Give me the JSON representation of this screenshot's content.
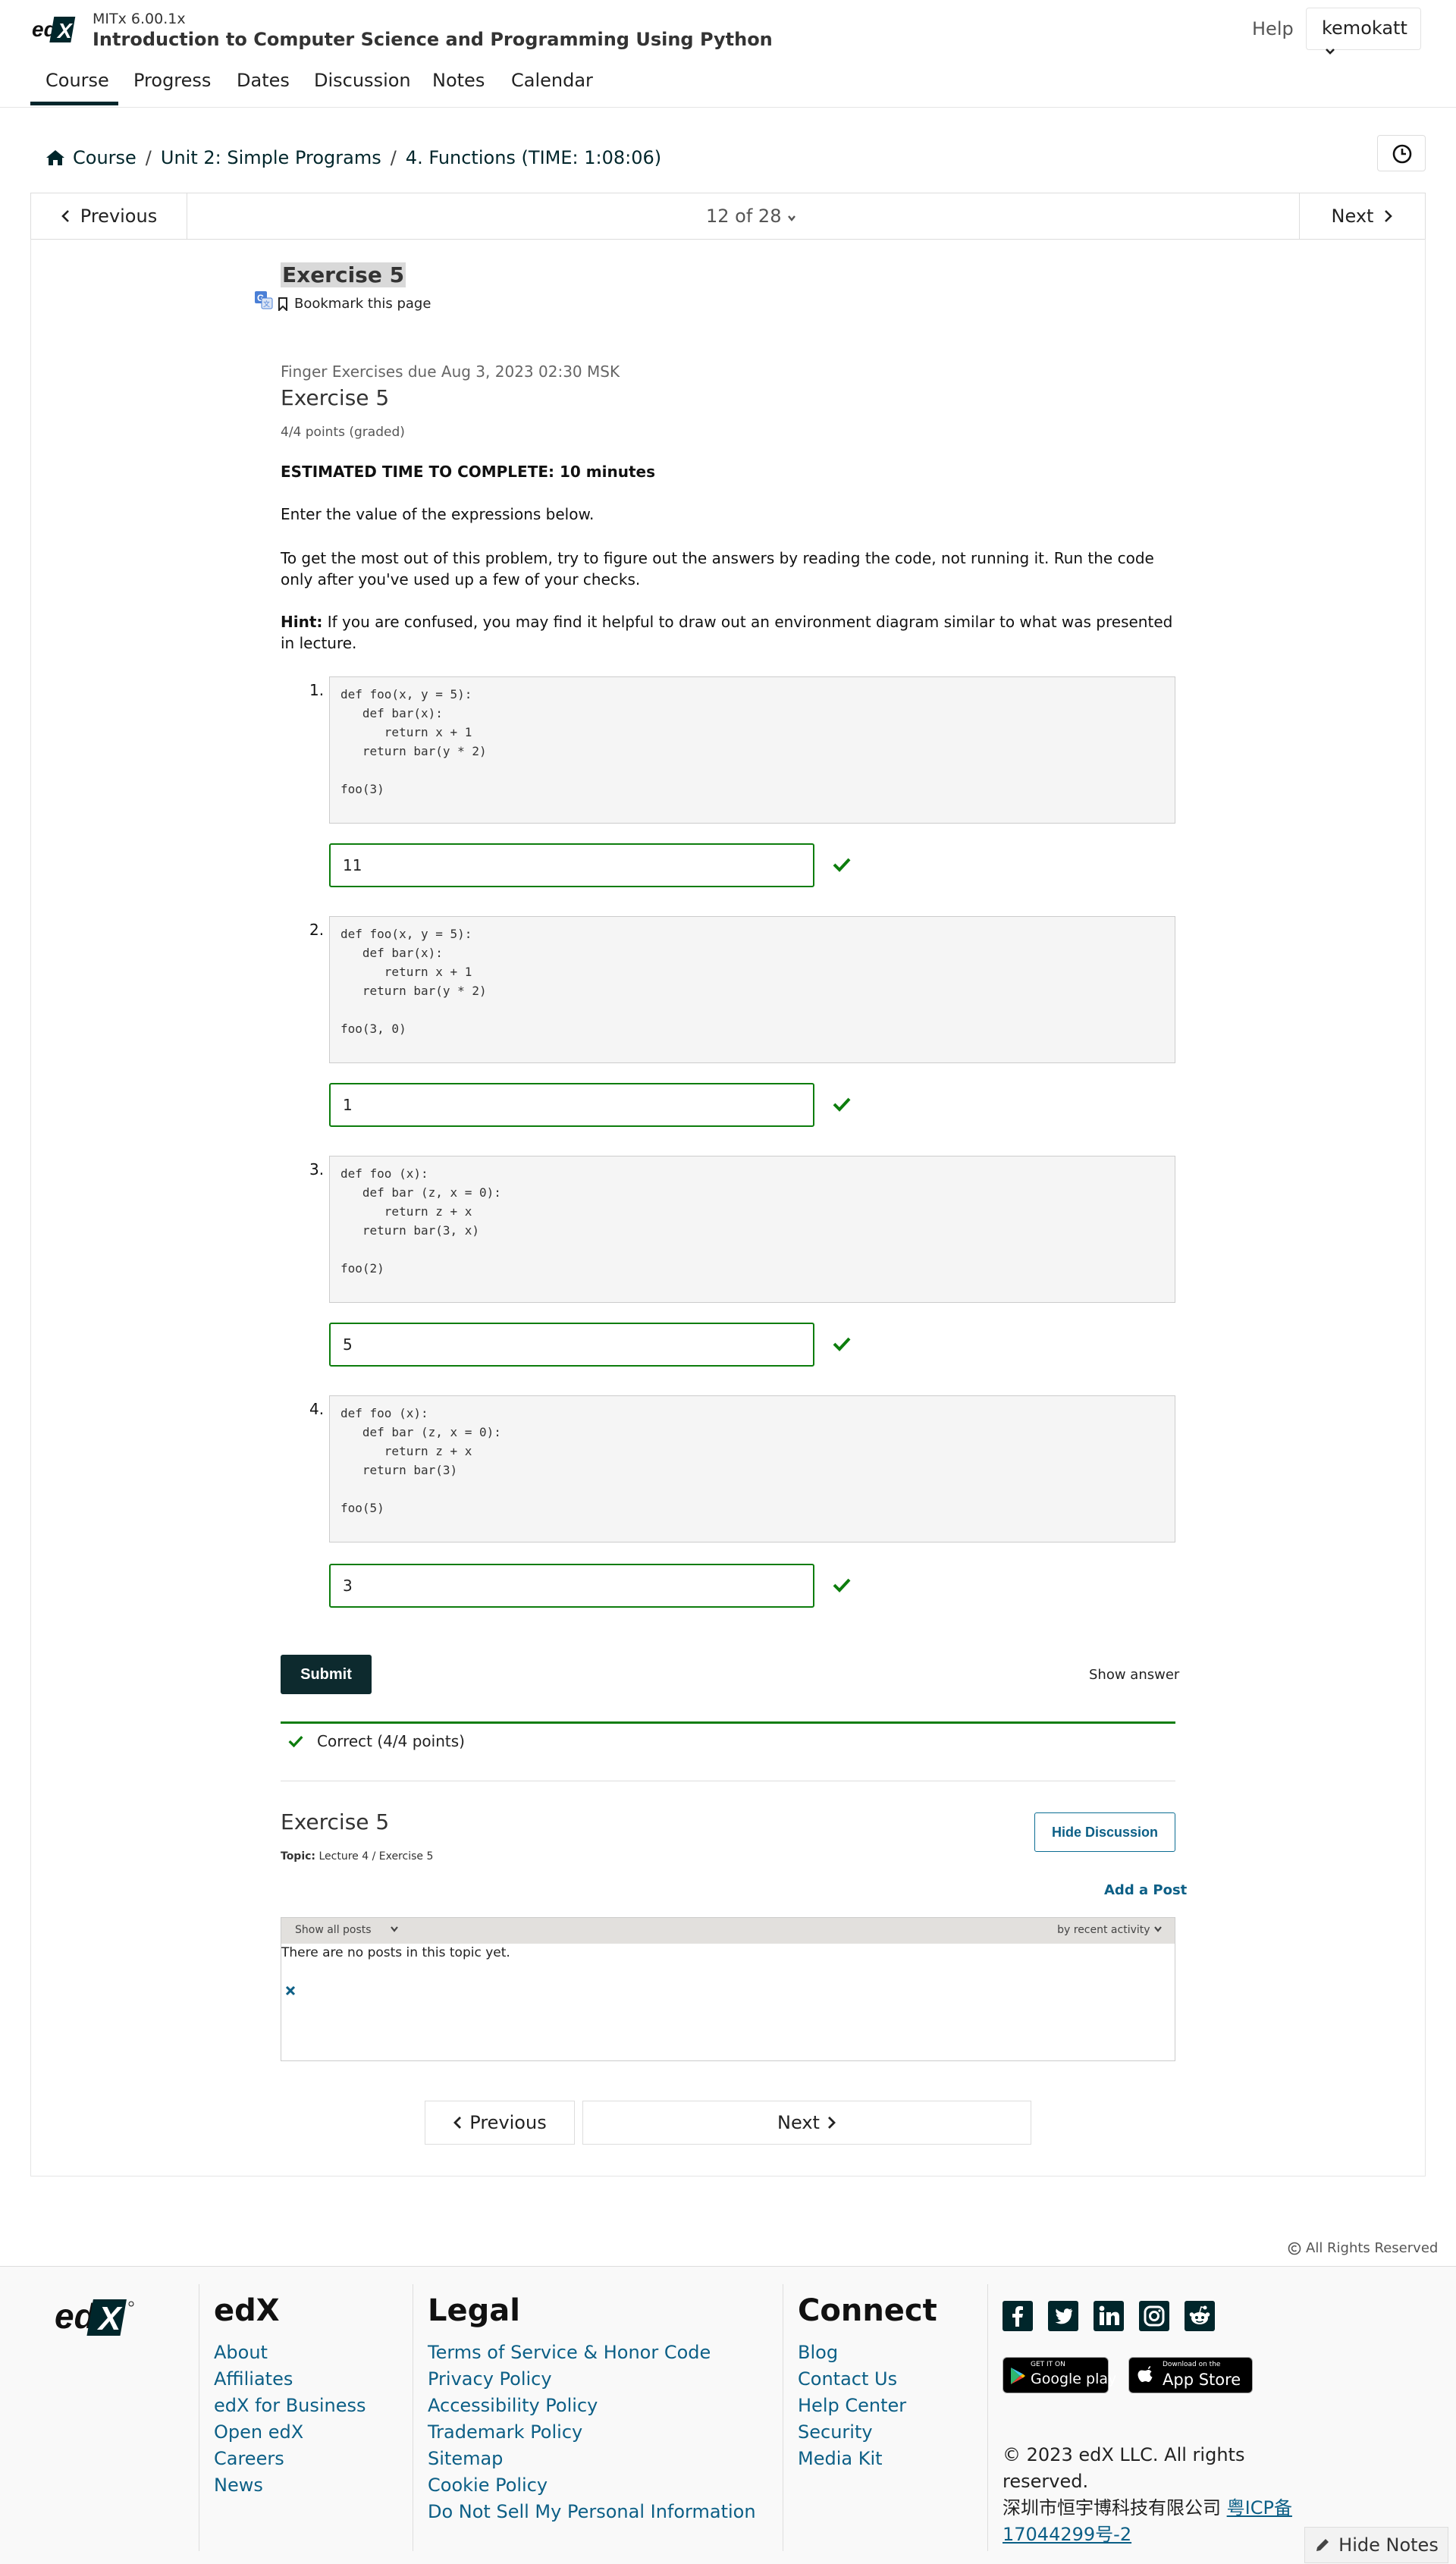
{
  "header": {
    "course_org": "MITx 6.00.1x",
    "course_title": "Introduction to Computer Science and Programming Using Python",
    "help": "Help",
    "username": "kemokatt",
    "tabs": [
      "Course",
      "Progress",
      "Dates",
      "Discussion",
      "Notes",
      "Calendar"
    ],
    "active_tab": "Course"
  },
  "breadcrumb": [
    "Course",
    "Unit 2: Simple Programs",
    "4. Functions (TIME: 1:08:06)"
  ],
  "sequence_nav": {
    "previous": "Previous",
    "position": "12 of 28",
    "next": "Next"
  },
  "unit": {
    "title": "Exercise 5",
    "bookmark": "Bookmark this page"
  },
  "problem": {
    "due": "Finger Exercises due Aug 3, 2023 02:30 MSK",
    "title": "Exercise 5",
    "points": "4/4 points (graded)",
    "estimated_time": "ESTIMATED TIME TO COMPLETE: 10 minutes",
    "instruction": "Enter the value of the expressions below.",
    "advice": "To get the most out of this problem, try to figure out the answers by reading the code, not running it. Run the code only after you've used up a few of your checks.",
    "hint_label": "Hint:",
    "hint_text": " If you are confused, you may find it helpful to draw out an environment diagram similar to what was presented in lecture.",
    "questions": [
      {
        "num": "1.",
        "code": "def foo(x, y = 5):\n   def bar(x):\n      return x + 1\n   return bar(y * 2)\n\nfoo(3)",
        "answer": "11",
        "status": "correct"
      },
      {
        "num": "2.",
        "code": "def foo(x, y = 5):\n   def bar(x):\n      return x + 1\n   return bar(y * 2)\n\nfoo(3, 0)",
        "answer": "1",
        "status": "correct"
      },
      {
        "num": "3.",
        "code": "def foo (x):\n   def bar (z, x = 0):\n      return z + x\n   return bar(3, x)\n\nfoo(2)",
        "answer": "5",
        "status": "correct"
      },
      {
        "num": "4.",
        "code": "def foo (x):\n   def bar (z, x = 0):\n      return z + x\n   return bar(3)\n\nfoo(5)",
        "answer": "3",
        "status": "correct"
      }
    ],
    "submit": "Submit",
    "show_answer": "Show answer",
    "result": "Correct (4/4 points)"
  },
  "discussion": {
    "title": "Exercise 5",
    "topic_label": "Topic:",
    "topic": " Lecture 4 / Exercise 5",
    "hide_button": "Hide Discussion",
    "add_post": "Add a Post",
    "filter": "Show all posts",
    "sort": "by recent activity",
    "empty": "There are no posts in this topic yet."
  },
  "bottom_nav": {
    "previous": "Previous",
    "next": "Next"
  },
  "all_rights": "All Rights Reserved",
  "footer": {
    "edx": {
      "heading": "edX",
      "links": [
        "About",
        "Affiliates",
        "edX for Business",
        "Open edX",
        "Careers",
        "News"
      ]
    },
    "legal": {
      "heading": "Legal",
      "links": [
        "Terms of Service & Honor Code",
        "Privacy Policy",
        "Accessibility Policy",
        "Trademark Policy",
        "Sitemap",
        "Cookie Policy",
        "Do Not Sell My Personal Information"
      ]
    },
    "connect": {
      "heading": "Connect",
      "links": [
        "Blog",
        "Contact Us",
        "Help Center",
        "Security",
        "Media Kit"
      ]
    },
    "social_icons": [
      "facebook-icon",
      "twitter-icon",
      "linkedin-icon",
      "instagram-icon",
      "reddit-icon"
    ],
    "google_play": {
      "small": "GET IT ON",
      "big": "Google play"
    },
    "app_store": {
      "small": "Download on the",
      "big": "App Store"
    },
    "copyright": "© 2023 edX LLC. All rights reserved.",
    "icp_text": "深圳市恒宇博科技有限公司",
    "icp_link": "粤ICP备17044299号-2"
  },
  "hide_notes": "Hide Notes",
  "colors": {
    "brand_dark": "#00262b",
    "success": "#0d7d0d",
    "link": "#0c5f86",
    "code_bg": "#f5f5f5"
  }
}
